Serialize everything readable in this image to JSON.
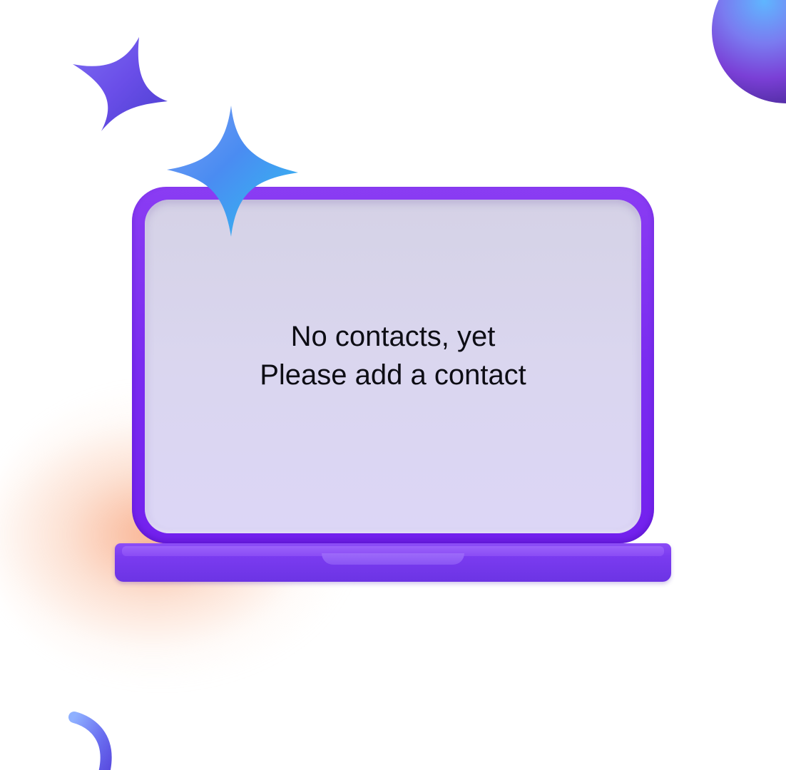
{
  "empty_state": {
    "line1": "No contacts, yet",
    "line2": "Please add a contact"
  },
  "icons": {
    "sparkle_small": "sparkle-icon",
    "sparkle_large": "sparkle-icon",
    "sphere": "sphere-decoration",
    "swirl": "swirl-decoration",
    "laptop": "laptop-illustration"
  },
  "colors": {
    "laptop_frame": "#7a2cf0",
    "screen": "#dad6ef",
    "text": "#0d0d14",
    "glow": "#f68c5a",
    "sparkle_violet": "#6a4ee8",
    "sparkle_blue": "#3aa3f0"
  }
}
